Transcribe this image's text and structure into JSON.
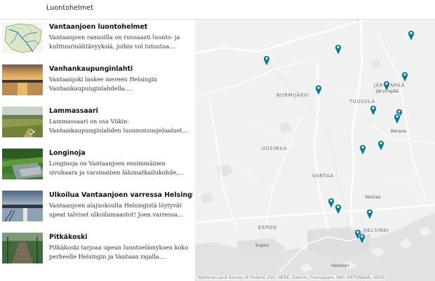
{
  "header": {
    "title": "Luontohelmet"
  },
  "cards": [
    {
      "title": "Vantaanjoen luontohelmet",
      "description": "Vantaanjoen rannoilla on runsaasti luonto- ja kulttuurinähtävyyksiä, joihin voi tutustua pyöräille..."
    },
    {
      "title": "Vanhankaupunginlahti",
      "description": "Vantaanjoki laskee mereen Helsingin Vanhankaupunginlahdella. Vesiensuojeluyhdistyks..."
    },
    {
      "title": "Lammassaari",
      "description": "Lammassaari on osa Viikin-Vanhankaupunginlahden luonnonsuojelualuetta ja se sijaitsee vain..."
    },
    {
      "title": "Longinoja",
      "description": "Longinoja on Vantaanjoen ensimmäinen sivuhaara ja varsinainen lähimatkailukohde, jonne päästäksesi ..."
    },
    {
      "title": "Ulkoilua Vantaanjoen varressa Helsingissä",
      "description": "Vantaanjoen alajuoksulta Helsingistä löytyvät upeat talviset ulkoilumaastot! Joen varressa kulkevat ladu..."
    },
    {
      "title": "Pitkäkoski",
      "description": "Pitkäkoski tarjoaa upean luontoelämyksen koko perheelle Helsingin ja Vantaan rajalla. Pitkäkoski o..."
    }
  ],
  "map": {
    "labels": {
      "nurmijarvi": "NURMIJÄRVI",
      "jarvenpaa_region": "JÄRVENPÄÄ",
      "jarvenpaa": "Järvenpää",
      "tuusula": "TUUSULA",
      "kerava": "Kerava",
      "uusimaa": "UUSIMAA",
      "vantaa_region": "VANTAA",
      "vantaa": "Vantaa",
      "espoo_region": "ESPOO",
      "espoo": "Espoo",
      "helsinki_region": "HELSINKI",
      "helsinki": "Helsinki"
    },
    "attribution": "National Land Survey of Finland, Esri, HERE, Garmin, Foursquare, FAO, METI/NASA, USGS",
    "pin_color": "#0a7c91",
    "marker_icon": "map-pin-icon"
  }
}
